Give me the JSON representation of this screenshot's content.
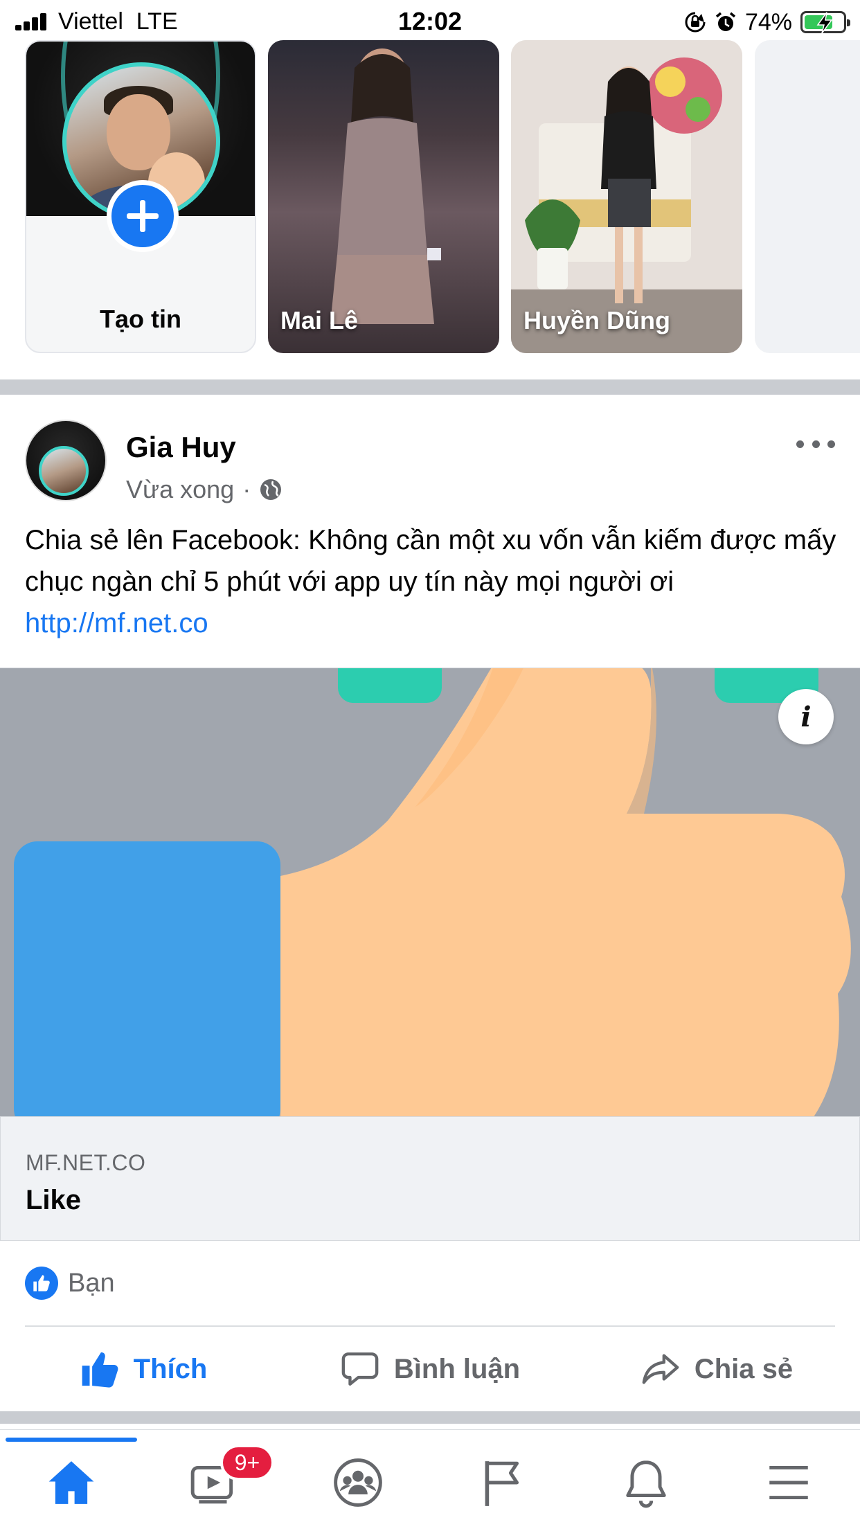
{
  "status_bar": {
    "carrier": "Viettel",
    "network": "LTE",
    "time": "12:02",
    "battery_percent": "74%",
    "battery_level": 0.74,
    "icons": [
      "signal-icon",
      "orientation-lock-icon",
      "alarm-icon",
      "battery-charging-icon"
    ]
  },
  "stories": {
    "create_label": "Tạo tin",
    "items": [
      {
        "name": "Mai Lê"
      },
      {
        "name": "Huyền Dũng"
      }
    ]
  },
  "post": {
    "author": "Gia Huy",
    "time": "Vừa xong",
    "separator": "·",
    "privacy_icon": "globe-icon",
    "text": "Chia sẻ lên Facebook: Không cần một xu vốn vẫn kiếm được mấy chục ngàn chỉ 5 phút với app uy tín này mọi người ơi ",
    "link_text": "http://mf.net.co",
    "preview": {
      "domain": "MF.NET.CO",
      "title": "Like",
      "info_label": "i"
    },
    "reactions": {
      "text": "Bạn"
    },
    "actions": {
      "like": "Thích",
      "comment": "Bình luận",
      "share": "Chia sẻ"
    }
  },
  "bottom_nav": {
    "video_badge": "9+",
    "items": [
      "home-icon",
      "video-icon",
      "groups-icon",
      "pages-icon",
      "notifications-icon",
      "menu-icon"
    ]
  },
  "colors": {
    "brand": "#1877f2",
    "badge": "#e41e3f",
    "secondary_text": "#65676b"
  }
}
